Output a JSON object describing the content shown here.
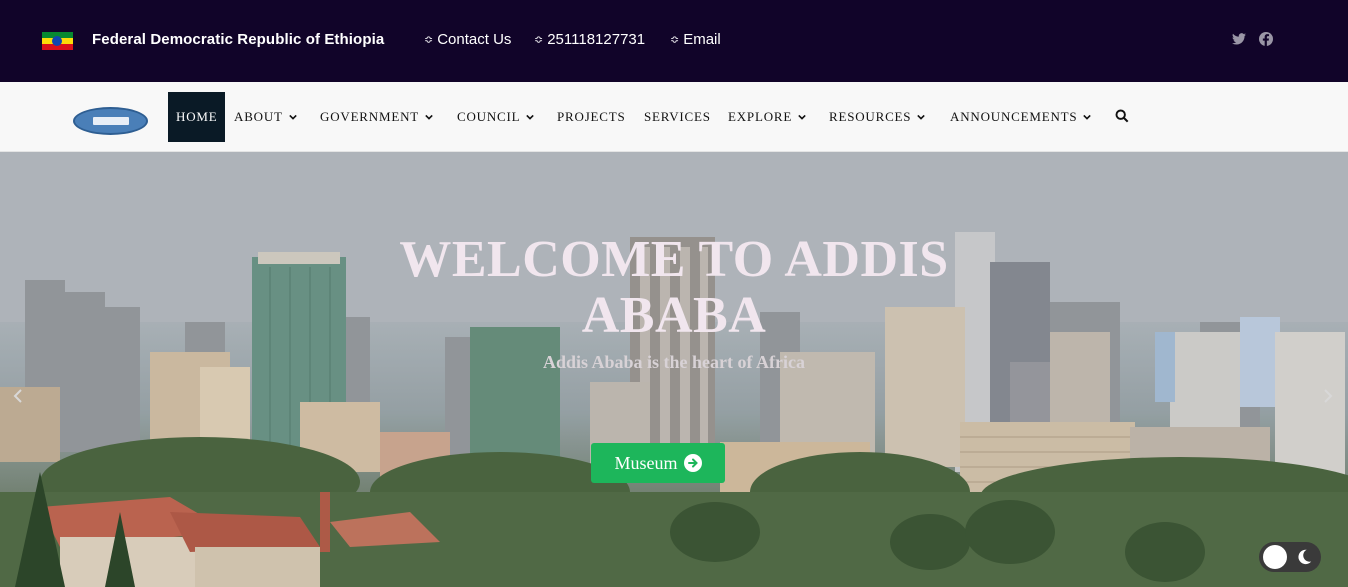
{
  "topbar": {
    "country": "Federal Democratic Republic of Ethiopia",
    "contact_label": "Contact Us",
    "phone": "251118127731",
    "email_label": "Email",
    "link_glyph": "≎",
    "social": [
      "twitter-icon",
      "facebook-icon"
    ]
  },
  "nav": {
    "items": [
      {
        "label": "HOME",
        "active": true,
        "dropdown": false
      },
      {
        "label": "ABOUT",
        "active": false,
        "dropdown": true
      },
      {
        "label": "GOVERNMENT",
        "active": false,
        "dropdown": true
      },
      {
        "label": "COUNCIL",
        "active": false,
        "dropdown": true
      },
      {
        "label": "PROJECTS",
        "active": false,
        "dropdown": false
      },
      {
        "label": "SERVICES",
        "active": false,
        "dropdown": false
      },
      {
        "label": "EXPLORE",
        "active": false,
        "dropdown": true
      },
      {
        "label": "RESOURCES",
        "active": false,
        "dropdown": true
      },
      {
        "label": "ANNOUNCEMENTS",
        "active": false,
        "dropdown": true
      }
    ]
  },
  "hero": {
    "title_line1": "WELCOME TO ADDIS",
    "title_line2": "ABABA",
    "subtitle": "Addis Ababa is the heart of Africa",
    "button_label": "Museum"
  },
  "colors": {
    "topbar_bg": "#110429",
    "nav_active_bg": "#0a1a26",
    "button_green": "#1db65b"
  }
}
